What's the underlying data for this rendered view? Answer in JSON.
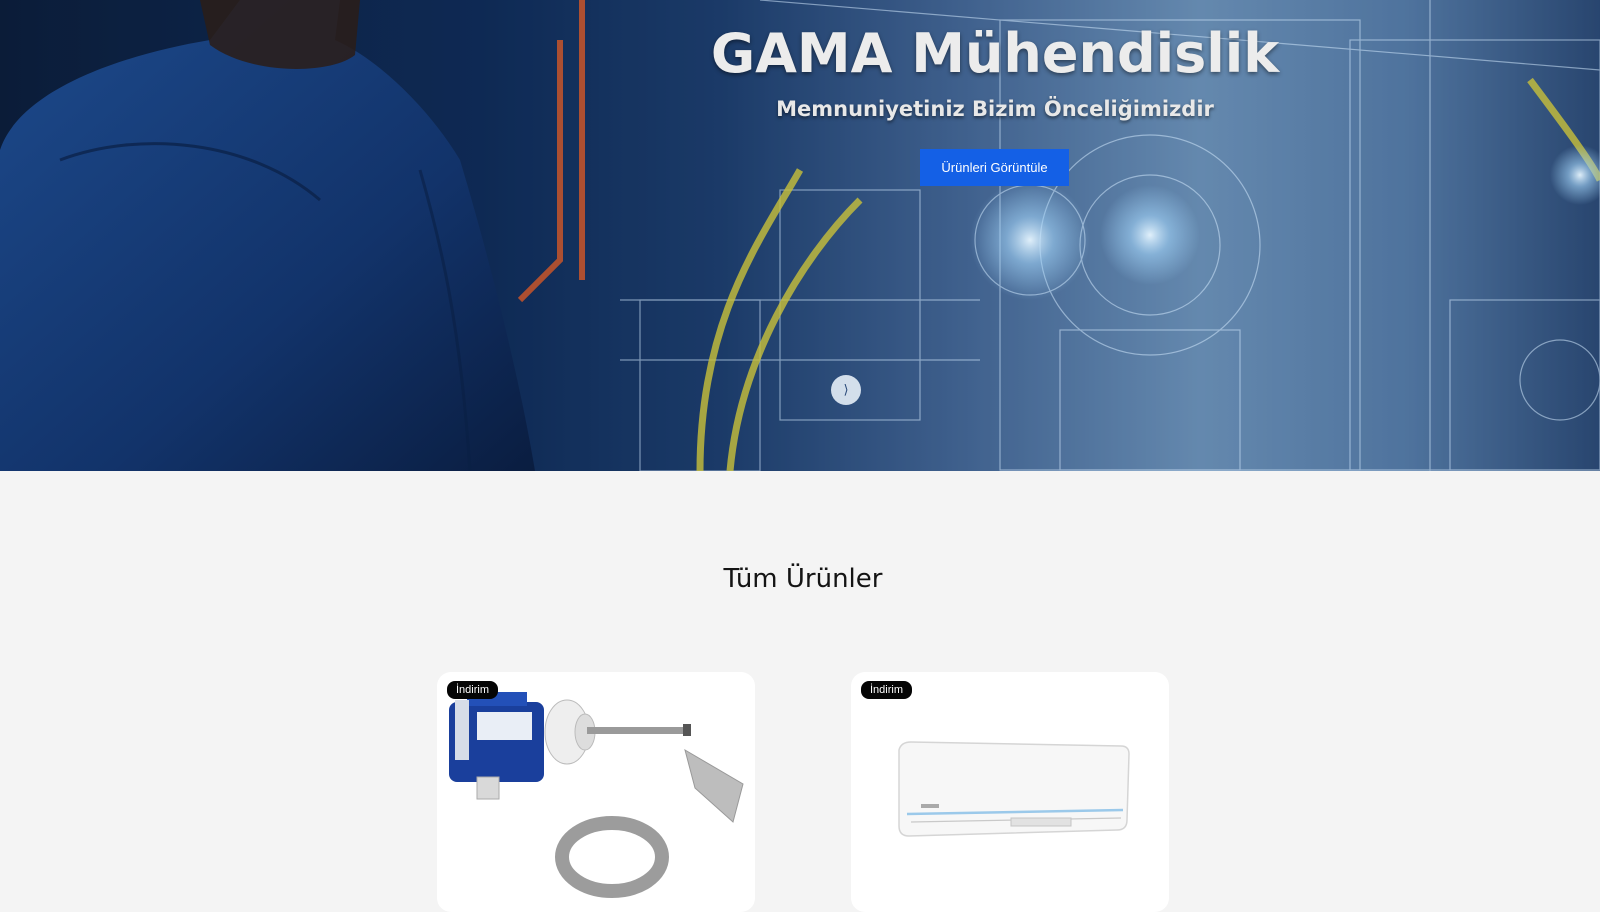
{
  "hero": {
    "title": "GAMA Mühendislik",
    "subtitle": "Memnuniyetiniz Bizim Önceliğimizdir",
    "button_label": "Ürünleri Görüntüle",
    "slider_dot_glyph": "⟩"
  },
  "products_section": {
    "title": "Tüm Ürünler",
    "products": [
      {
        "badge": "İndirim",
        "image_icon": "flow-switch-image"
      },
      {
        "badge": "İndirim",
        "image_icon": "air-conditioner-image"
      }
    ]
  },
  "colors": {
    "accent": "#1460e6",
    "badge_bg": "#050505",
    "page_bg": "#f4f4f4"
  }
}
